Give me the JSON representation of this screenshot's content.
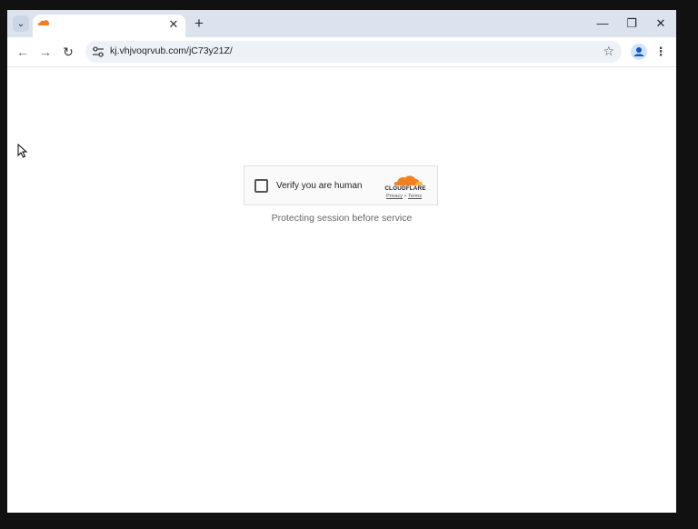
{
  "browser": {
    "tab": {
      "title": "",
      "favicon": "cloudflare-favicon",
      "close_label": "✕"
    },
    "newtab_label": "+",
    "window_controls": {
      "minimize": "—",
      "restore": "❐",
      "close": "✕"
    },
    "nav": {
      "back": "←",
      "forward": "→",
      "reload": "↻"
    },
    "address": {
      "url": "kj.vhjvoqrvub.com/jC73y21Z/"
    },
    "bookmark_icon": "☆",
    "menu_icon": "⋮"
  },
  "challenge": {
    "checkbox_label": "Verify you are human",
    "checked": false,
    "brand": "CLOUDFLARE",
    "privacy_label": "Privacy",
    "separator": "•",
    "terms_label": "Terms",
    "brand_color": "#f38020"
  },
  "status_text": "Protecting session before service"
}
